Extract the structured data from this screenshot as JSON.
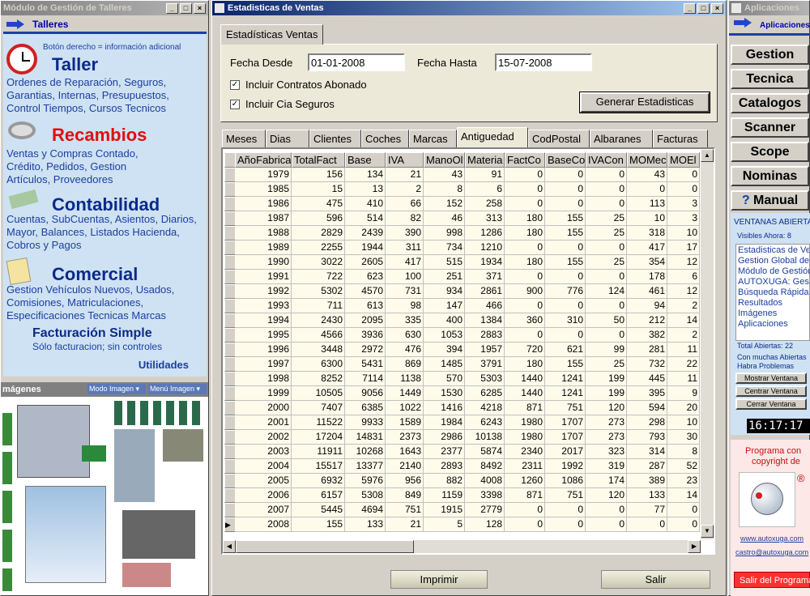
{
  "left": {
    "title": "Módulo de Gestión de Talleres",
    "header": "Talleres",
    "hint": "Botón derecho = información adicional",
    "taller": {
      "title": "Taller",
      "links": "Ordenes de Reparación, Seguros, Garantias, Internas, Presupuestos, Control Tiempos, Cursos Tecnicos"
    },
    "recambios": {
      "title": "Recambios",
      "links": "Ventas y Compras Contado, Crédito, Pedidos, Gestion Artículos, Proveedores"
    },
    "contabilidad": {
      "title": "Contabilidad",
      "links": "Cuentas, SubCuentas, Asientos, Diarios, Mayor, Balances, Listados Hacienda, Cobros y Pagos"
    },
    "comercial": {
      "title": "Comercial",
      "links": "Gestion Vehículos Nuevos, Usados, Comisiones, Matriculaciones, Especificaciones Tecnicas Marcas"
    },
    "factura": {
      "title": "Facturación Simple",
      "sub": "Sólo facturacion; sin controles"
    },
    "utilidades": "Utilidades",
    "images_title": "mágenes",
    "modo_imagen": "Modo Imagen",
    "menu_imagen": "Menú Imagen"
  },
  "main": {
    "title": "Estadisticas de Ventas",
    "top_tab": "Estadísticas Ventas",
    "fecha_desde_label": "Fecha Desde",
    "fecha_desde": "01-01-2008",
    "fecha_hasta_label": "Fecha Hasta",
    "fecha_hasta": "15-07-2008",
    "chk1": "Incluir Contratos Abonado",
    "chk2": "Incluir Cia Seguros",
    "generar": "Generar Estadisticas",
    "tabs": [
      "Meses",
      "Dias",
      "Clientes",
      "Coches",
      "Marcas",
      "Antiguedad",
      "CodPostal",
      "Albaranes",
      "Facturas"
    ],
    "columns": [
      "AñoFabrica",
      "TotalFact",
      "Base",
      "IVA",
      "ManoOl",
      "Materia",
      "FactCo",
      "BaseCo",
      "IVACon",
      "MOMec",
      "MOEl"
    ],
    "rows": [
      [
        "1979",
        "156",
        "134",
        "21",
        "43",
        "91",
        "0",
        "0",
        "0",
        "43",
        "0"
      ],
      [
        "1985",
        "15",
        "13",
        "2",
        "8",
        "6",
        "0",
        "0",
        "0",
        "0",
        "0"
      ],
      [
        "1986",
        "475",
        "410",
        "66",
        "152",
        "258",
        "0",
        "0",
        "0",
        "113",
        "3"
      ],
      [
        "1987",
        "596",
        "514",
        "82",
        "46",
        "313",
        "180",
        "155",
        "25",
        "10",
        "3"
      ],
      [
        "1988",
        "2829",
        "2439",
        "390",
        "998",
        "1286",
        "180",
        "155",
        "25",
        "318",
        "10"
      ],
      [
        "1989",
        "2255",
        "1944",
        "311",
        "734",
        "1210",
        "0",
        "0",
        "0",
        "417",
        "17"
      ],
      [
        "1990",
        "3022",
        "2605",
        "417",
        "515",
        "1934",
        "180",
        "155",
        "25",
        "354",
        "12"
      ],
      [
        "1991",
        "722",
        "623",
        "100",
        "251",
        "371",
        "0",
        "0",
        "0",
        "178",
        "6"
      ],
      [
        "1992",
        "5302",
        "4570",
        "731",
        "934",
        "2861",
        "900",
        "776",
        "124",
        "461",
        "12"
      ],
      [
        "1993",
        "711",
        "613",
        "98",
        "147",
        "466",
        "0",
        "0",
        "0",
        "94",
        "2"
      ],
      [
        "1994",
        "2430",
        "2095",
        "335",
        "400",
        "1384",
        "360",
        "310",
        "50",
        "212",
        "14"
      ],
      [
        "1995",
        "4566",
        "3936",
        "630",
        "1053",
        "2883",
        "0",
        "0",
        "0",
        "382",
        "2"
      ],
      [
        "1996",
        "3448",
        "2972",
        "476",
        "394",
        "1957",
        "720",
        "621",
        "99",
        "281",
        "11"
      ],
      [
        "1997",
        "6300",
        "5431",
        "869",
        "1485",
        "3791",
        "180",
        "155",
        "25",
        "732",
        "22"
      ],
      [
        "1998",
        "8252",
        "7114",
        "1138",
        "570",
        "5303",
        "1440",
        "1241",
        "199",
        "445",
        "11"
      ],
      [
        "1999",
        "10505",
        "9056",
        "1449",
        "1530",
        "6285",
        "1440",
        "1241",
        "199",
        "395",
        "9"
      ],
      [
        "2000",
        "7407",
        "6385",
        "1022",
        "1416",
        "4218",
        "871",
        "751",
        "120",
        "594",
        "20"
      ],
      [
        "2001",
        "11522",
        "9933",
        "1589",
        "1984",
        "6243",
        "1980",
        "1707",
        "273",
        "298",
        "10"
      ],
      [
        "2002",
        "17204",
        "14831",
        "2373",
        "2986",
        "10138",
        "1980",
        "1707",
        "273",
        "793",
        "30"
      ],
      [
        "2003",
        "11911",
        "10268",
        "1643",
        "2377",
        "5874",
        "2340",
        "2017",
        "323",
        "314",
        "8"
      ],
      [
        "2004",
        "15517",
        "13377",
        "2140",
        "2893",
        "8492",
        "2311",
        "1992",
        "319",
        "287",
        "52"
      ],
      [
        "2005",
        "6932",
        "5976",
        "956",
        "882",
        "4008",
        "1260",
        "1086",
        "174",
        "389",
        "23"
      ],
      [
        "2006",
        "6157",
        "5308",
        "849",
        "1159",
        "3398",
        "871",
        "751",
        "120",
        "133",
        "14"
      ],
      [
        "2007",
        "5445",
        "4694",
        "751",
        "1915",
        "2779",
        "0",
        "0",
        "0",
        "77",
        "0"
      ],
      [
        "2008",
        "155",
        "133",
        "21",
        "5",
        "128",
        "0",
        "0",
        "0",
        "0",
        "0"
      ]
    ],
    "imprimir": "Imprimir",
    "salir": "Salir"
  },
  "right": {
    "title": "Aplicaciones",
    "header": "Aplicaciones",
    "buttons": [
      "Gestion",
      "Tecnica",
      "Catalogos",
      "Scanner",
      "Scope",
      "Nominas",
      "Manual"
    ],
    "ventanas_title": "VENTANAS ABIERTA",
    "visibles": "Visibles Ahora: 8",
    "ventanas": [
      "Estadisticas de Ve",
      "Gestion Global de",
      "Módulo de Gestión",
      "AUTOXUGA: Ges",
      "Búsqueda Rápida",
      "Resultados",
      "Imágenes",
      "Aplicaciones"
    ],
    "total": "Total Abiertas: 22",
    "muchas1": "Con muchas Abiertas",
    "muchas2": "Habra Problemas",
    "mostrar": "Mostrar Ventana",
    "centrar": "Centrar Ventana",
    "cerrar": "Cerrar Ventana",
    "clock": "16:17:17",
    "copyright1": "Programa con",
    "copyright2": "copyright de",
    "web": "www.autoxuga.com",
    "email": "castro@autoxuga.com",
    "salir": "Salir del Programa"
  }
}
